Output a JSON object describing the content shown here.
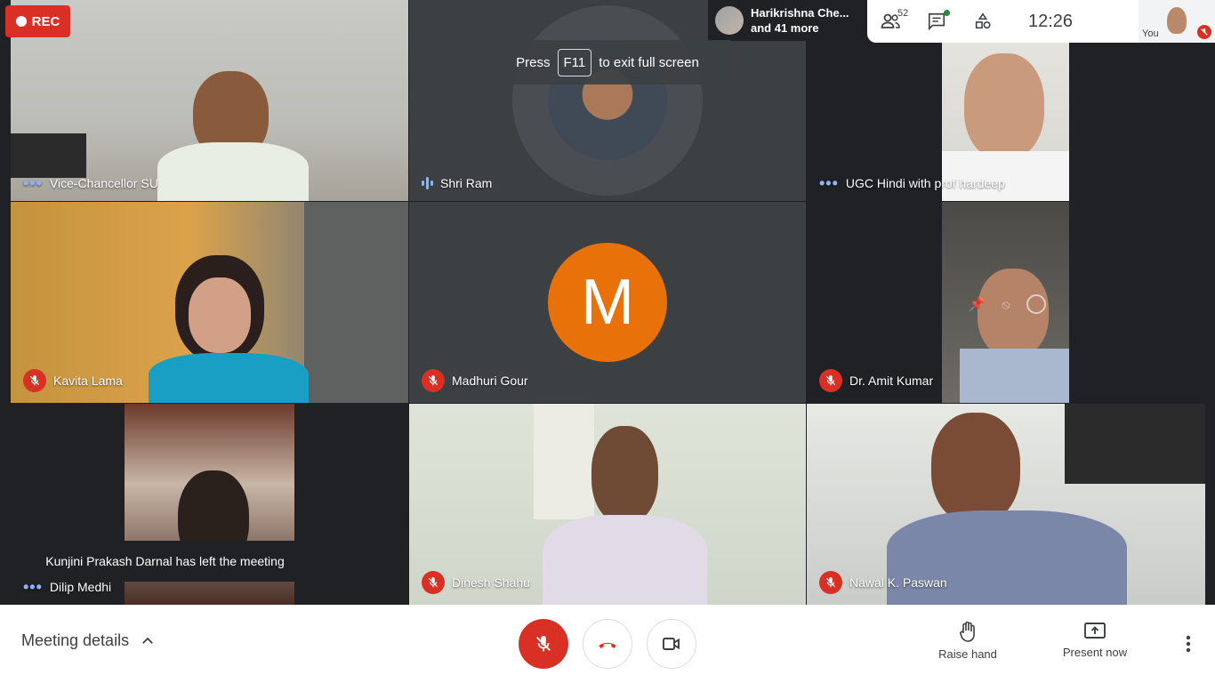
{
  "recording": {
    "label": "REC"
  },
  "presenter": {
    "line1": "Harikrishna Che...",
    "line2": "and 41 more"
  },
  "topbar": {
    "participant_count": "52",
    "time": "12:26",
    "self_label": "You"
  },
  "fullscreen_toast": {
    "prefix": "Press",
    "key": "F11",
    "suffix": "to exit full screen"
  },
  "tiles": [
    {
      "name": "Vice-Chancellor SU",
      "status": "dots"
    },
    {
      "name": "Shri Ram",
      "status": "speaking"
    },
    {
      "name": "UGC Hindi with prof hardeep",
      "status": "dots"
    },
    {
      "name": "Kavita Lama",
      "status": "muted"
    },
    {
      "name": "Madhuri Gour",
      "status": "muted",
      "avatar_letter": "M",
      "avatar_color": "#e8710a"
    },
    {
      "name": "Dr. Amit Kumar",
      "status": "muted"
    },
    {
      "name": "Dilip Medhi",
      "status": "dots"
    },
    {
      "name": "Dinesh Shahu",
      "status": "muted"
    },
    {
      "name": "Nawal K. Paswan",
      "status": "muted"
    }
  ],
  "notification": "Kunjini Prakash Darnal has left the meeting",
  "bottombar": {
    "meeting_details": "Meeting details",
    "raise_hand": "Raise hand",
    "present_now": "Present now"
  },
  "colors": {
    "danger": "#d93025",
    "accent": "#8ab4f8",
    "surface": "#202124"
  },
  "icons": [
    "people-icon",
    "chat-icon",
    "activities-icon",
    "mic-off-icon",
    "call-end-icon",
    "camera-icon",
    "hand-icon",
    "present-icon",
    "more-vert-icon",
    "chevron-up-icon"
  ]
}
